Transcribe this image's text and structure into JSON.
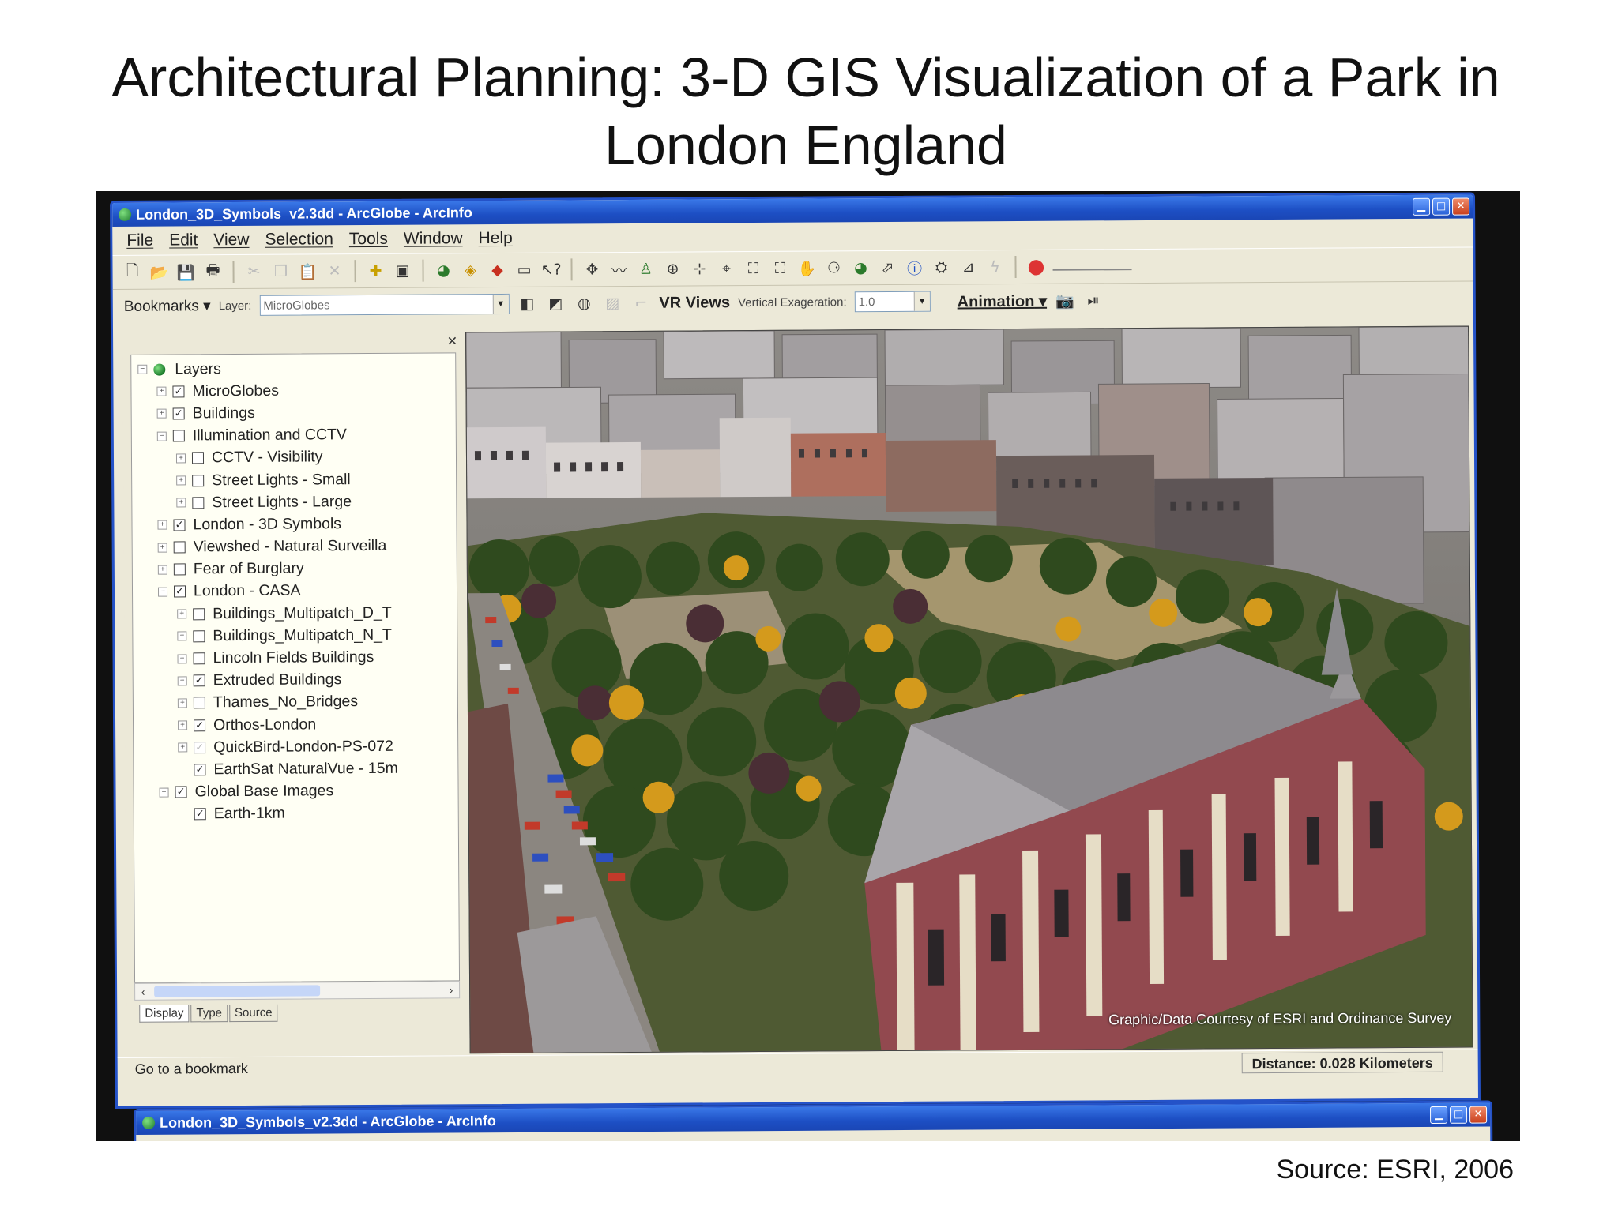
{
  "slide": {
    "title": "Architectural Planning: 3-D GIS Visualization of a Park in London England",
    "source": "Source: ESRI, 2006"
  },
  "window": {
    "title": "London_3D_Symbols_v2.3dd - ArcGlobe - ArcInfo",
    "controls": [
      "minimize-icon",
      "maximize-icon",
      "close-icon"
    ]
  },
  "menu": [
    "File",
    "Edit",
    "View",
    "Selection",
    "Tools",
    "Window",
    "Help"
  ],
  "toolbar2": {
    "bookmarks_label": "Bookmarks",
    "layer_label": "Layer:",
    "layer_value": "MicroGlobes",
    "vr_views_label": "VR Views",
    "vertical_exaggeration_label": "Vertical Exageration:",
    "vertical_exaggeration_value": "1.0",
    "animation_label": "Animation"
  },
  "toc": {
    "items": [
      {
        "label": "Layers",
        "level": 0,
        "expander": "−",
        "type": "globe"
      },
      {
        "label": "MicroGlobes",
        "level": 1,
        "expander": "+",
        "checked": true
      },
      {
        "label": "Buildings",
        "level": 1,
        "expander": "+",
        "checked": true
      },
      {
        "label": "Illumination and CCTV",
        "level": 1,
        "expander": "−",
        "checked": false
      },
      {
        "label": "CCTV - Visibility",
        "level": 2,
        "expander": "+",
        "checked": false
      },
      {
        "label": "Street Lights - Small",
        "level": 2,
        "expander": "+",
        "checked": false
      },
      {
        "label": "Street Lights - Large",
        "level": 2,
        "expander": "+",
        "checked": false
      },
      {
        "label": "London - 3D Symbols",
        "level": 1,
        "expander": "+",
        "checked": true
      },
      {
        "label": "Viewshed - Natural Surveilla",
        "level": 1,
        "expander": "+",
        "checked": false
      },
      {
        "label": "Fear of Burglary",
        "level": 1,
        "expander": "+",
        "checked": false
      },
      {
        "label": "London - CASA",
        "level": 1,
        "expander": "−",
        "checked": true
      },
      {
        "label": "Buildings_Multipatch_D_T",
        "level": 2,
        "expander": "+",
        "checked": false
      },
      {
        "label": "Buildings_Multipatch_N_T",
        "level": 2,
        "expander": "+",
        "checked": false
      },
      {
        "label": "Lincoln Fields Buildings",
        "level": 2,
        "expander": "+",
        "checked": false
      },
      {
        "label": "Extruded Buildings",
        "level": 2,
        "expander": "+",
        "checked": true
      },
      {
        "label": "Thames_No_Bridges",
        "level": 2,
        "expander": "+",
        "checked": false
      },
      {
        "label": "Orthos-London",
        "level": 2,
        "expander": "+",
        "checked": true
      },
      {
        "label": "QuickBird-London-PS-072",
        "level": 2,
        "expander": "+",
        "checked": "gray"
      },
      {
        "label": "EarthSat NaturalVue - 15m",
        "level": 2,
        "expander": "",
        "checked": true
      },
      {
        "label": "Global Base Images",
        "level": 1,
        "expander": "−",
        "checked": true
      },
      {
        "label": "Earth-1km",
        "level": 2,
        "expander": "",
        "checked": true
      }
    ],
    "tabs": [
      "Display",
      "Type",
      "Source"
    ]
  },
  "view": {
    "credit": "Graphic/Data Courtesy of ESRI and Ordinance Survey"
  },
  "status": {
    "message": "Go to a bookmark",
    "distance": "Distance:  0.028 Kilometers"
  },
  "window2": {
    "title": "London_3D_Symbols_v2.3dd - ArcGlobe - ArcInfo"
  },
  "colors": {
    "titlebar": "#1d4fc4",
    "chrome": "#ece9d8",
    "foliage": "#2f4a1e",
    "autumn_tree": "#d49a1c"
  }
}
